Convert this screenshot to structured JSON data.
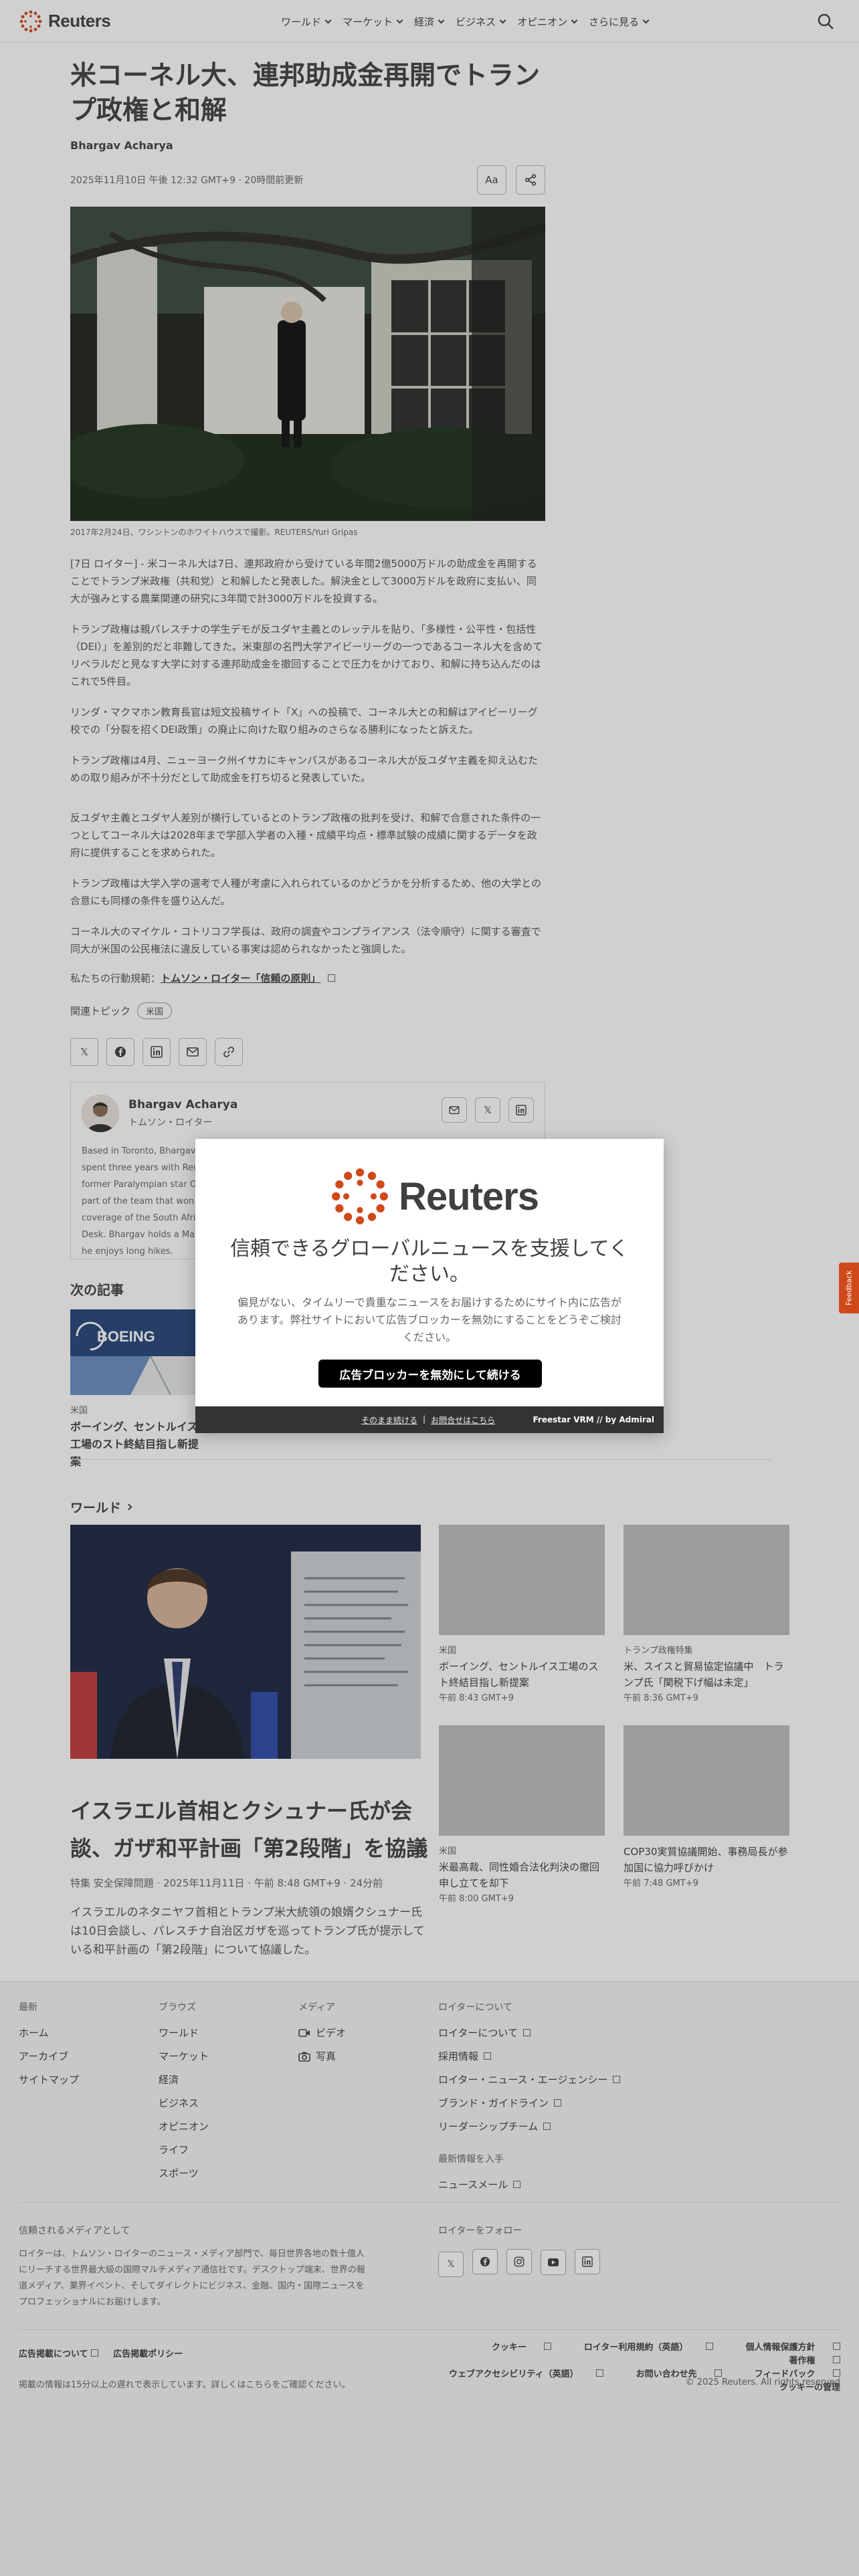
{
  "header": {
    "logo_text": "Reuters",
    "nav": [
      "ワールド",
      "マーケット",
      "経済",
      "ビジネス",
      "オピニオン",
      "さらに見る"
    ]
  },
  "article": {
    "headline": "米コーネル大、連邦助成金再開でトランプ政権と和解",
    "author": "Bhargav Acharya",
    "dateline": "2025年11月10日 午後 12:32 GMT+9 · 20時間前更新",
    "text_size_label": "Aa",
    "hero_caption": "2017年2月24日、ワシントンのホワイトハウスで撮影。REUTERS/Yuri Gripas",
    "paragraphs": [
      "[7日 ロイター] - 米コーネル大は7日、連邦政府から受けている年間2億5000万ドルの助成金を再開することでトランプ米政権（共和党）と和解したと発表した。解決金として3000万ドルを政府に支払い、同大が強みとする農業関連の研究に3年間で計3000万ドルを投資する。",
      "トランプ政権は親パレスチナの学生デモが反ユダヤ主義とのレッテルを貼り、「多様性・公平性・包括性（DEI）」を差別的だと非難してきた。米東部の名門大学アイビーリーグの一つであるコーネル大を含めてリベラルだと見なす大学に対する連邦助成金を撤回することで圧力をかけており、和解に持ち込んだのはこれで5件目。",
      "リンダ・マクマホン教育長官は短文投稿サイト「X」への投稿で、コーネル大との和解はアイビーリーグ校での「分裂を招くDEI政策」の廃止に向けた取り組みのさらなる勝利になったと訴えた。",
      "トランプ政権は4月、ニューヨーク州イサカにキャンパスがあるコーネル大が反ユダヤ主義を抑え込むための取り組みが不十分だとして助成金を打ち切ると発表していた。",
      "反ユダヤ主義とユダヤ人差別が横行しているとのトランプ政権の批判を受け、和解で合意された条件の一つとしてコーネル大は2028年まで学部入学者の入種・成績平均点・標準試験の成績に関するデータを政府に提供することを求められた。",
      "トランプ政権は大学入学の選考で人種が考慮に入れられているのかどうかを分析するため、他の大学との合意にも同様の条件を盛り込んだ。",
      "コーネル大のマイケル・コトリコフ学長は、政府の調査やコンプライアンス（法令順守）に関する審査で同大が米国の公民権法に違反している事実は認められなかったと強調した。"
    ],
    "principles_prefix": "私たちの行動規範：",
    "principles_link": "トムソン・ロイター「信頼の原則」",
    "topics_label": "関連トピック",
    "topic_chip": "米国"
  },
  "author_card": {
    "name": "Bhargav Acharya",
    "org": "トムソン・ロイター",
    "bio": "Based in Toronto, Bhargav Acharya reports on breaking news across U.S. and Canada. Previously he spent three years with Reuters' Sub-Saharan Africa breaking news hub in Johannesburg, and covered former Paralympian star Oscar Pistorius's release, and the historic 2024 South African election. He was part of the team that won the Reuters Journalist of the Year award 2024 in the Speed category for coverage of the South African election and others, and was part of the news agency's Global News Desk. Bhargav holds a Master's in Journalism and Development Studies. When he is not covering news he enjoys long hikes."
  },
  "next": {
    "title": "次の記事",
    "card": {
      "kicker": "米国",
      "title": "ボーイング、セントルイス工場のスト終結目指し新提案",
      "img_text": "BOEING"
    }
  },
  "world": {
    "title": "ワールド",
    "main": {
      "title": "イスラエル首相とクシュナー氏が会談、ガザ和平計画「第2段階」を協議",
      "meta": "特集 安全保障問題 · 2025年11月11日 · 午前 8:48 GMT+9 · 24分前",
      "desc": "イスラエルのネタニヤフ首相とトランプ米大統領の娘婿クシュナー氏は10日会談し、パレスチナ自治区ガザを巡ってトランプ氏が提示している和平計画の「第2段階」について協議した。"
    },
    "cards": [
      {
        "kicker": "米国",
        "title": "ボーイング、セントルイス工場のスト終結目指し新提案",
        "time": "午前 8:43 GMT+9"
      },
      {
        "kicker": "トランプ政権特集",
        "title": "米、スイスと貿易協定協議中　トランプ氏「関税下げ幅は未定」",
        "time": "午前 8:36 GMT+9"
      },
      {
        "kicker": "米国",
        "title": "米最高裁、同性婚合法化判決の撤回申し立てを却下",
        "time": "午前 8:00 GMT+9"
      },
      {
        "kicker": "",
        "title": "COP30実質協議開始、事務局長が参加国に協力呼びかけ",
        "time": "午前 7:48 GMT+9"
      }
    ]
  },
  "footer": {
    "latest": {
      "head": "最新",
      "links": [
        "ホーム",
        "アーカイブ",
        "サイトマップ"
      ]
    },
    "browse": {
      "head": "ブラウズ",
      "links": [
        "ワールド",
        "マーケット",
        "経済",
        "ビジネス",
        "オピニオン",
        "ライフ",
        "スポーツ"
      ]
    },
    "media": {
      "head": "メディア",
      "links": [
        "ビデオ",
        "写真"
      ]
    },
    "about": {
      "head": "ロイターについて",
      "links": [
        "ロイターについて",
        "採用情報",
        "ロイター・ニュース・エージェンシー",
        "ブランド・ガイドライン",
        "リーダーシップチーム"
      ]
    },
    "updates": {
      "head": "最新情報を入手",
      "link": "ニュースメール"
    },
    "trusted": {
      "head": "信頼されるメディアとして",
      "text": "ロイターは、トムソン・ロイターのニュース・メディア部門で、毎日世界各地の数十億人にリーチする世界最大級の国際マルチメディア通信社です。デスクトップ端末、世界の報道メディア、業界イベント、そしてダイレクトにビジネス、金融、国内・国際ニュースをプロフェッショナルにお届けします。"
    },
    "follow_head": "ロイターをフォロー",
    "legal_left": [
      "広告掲載について",
      "広告掲載ポリシー"
    ],
    "legal_right": [
      "クッキー",
      "ロイター利用規約（英語）",
      "個人情報保護方針",
      "著作権",
      "ウェブアクセシビリティ（英語）",
      "お問い合わせ先",
      "フィードバック",
      "クッキーの管理"
    ],
    "delay": "掲載の情報は15分以上の遅れで表示しています。詳しくはこちらをご確認ください。",
    "copyright": "© 2025 Reuters. All rights reserved"
  },
  "modal": {
    "logo_text": "Reuters",
    "title": "信頼できるグローバルニュースを支援してください。",
    "body": "偏見がない、タイムリーで貴重なニュースをお届けするためにサイト内に広告があります。弊社サイトにおいて広告ブロッカーを無効にすることをどうぞご検討ください。",
    "button": "広告ブロッカーを無効にして続ける",
    "link_continue": "そのまま続ける",
    "link_contact": "お問合せはこちら",
    "brand": "Freestar VRM // by Admiral"
  },
  "feedback_label": "Feedback",
  "colors": {
    "brand": "#d0491a",
    "text": "#404040",
    "button": "#000000"
  }
}
